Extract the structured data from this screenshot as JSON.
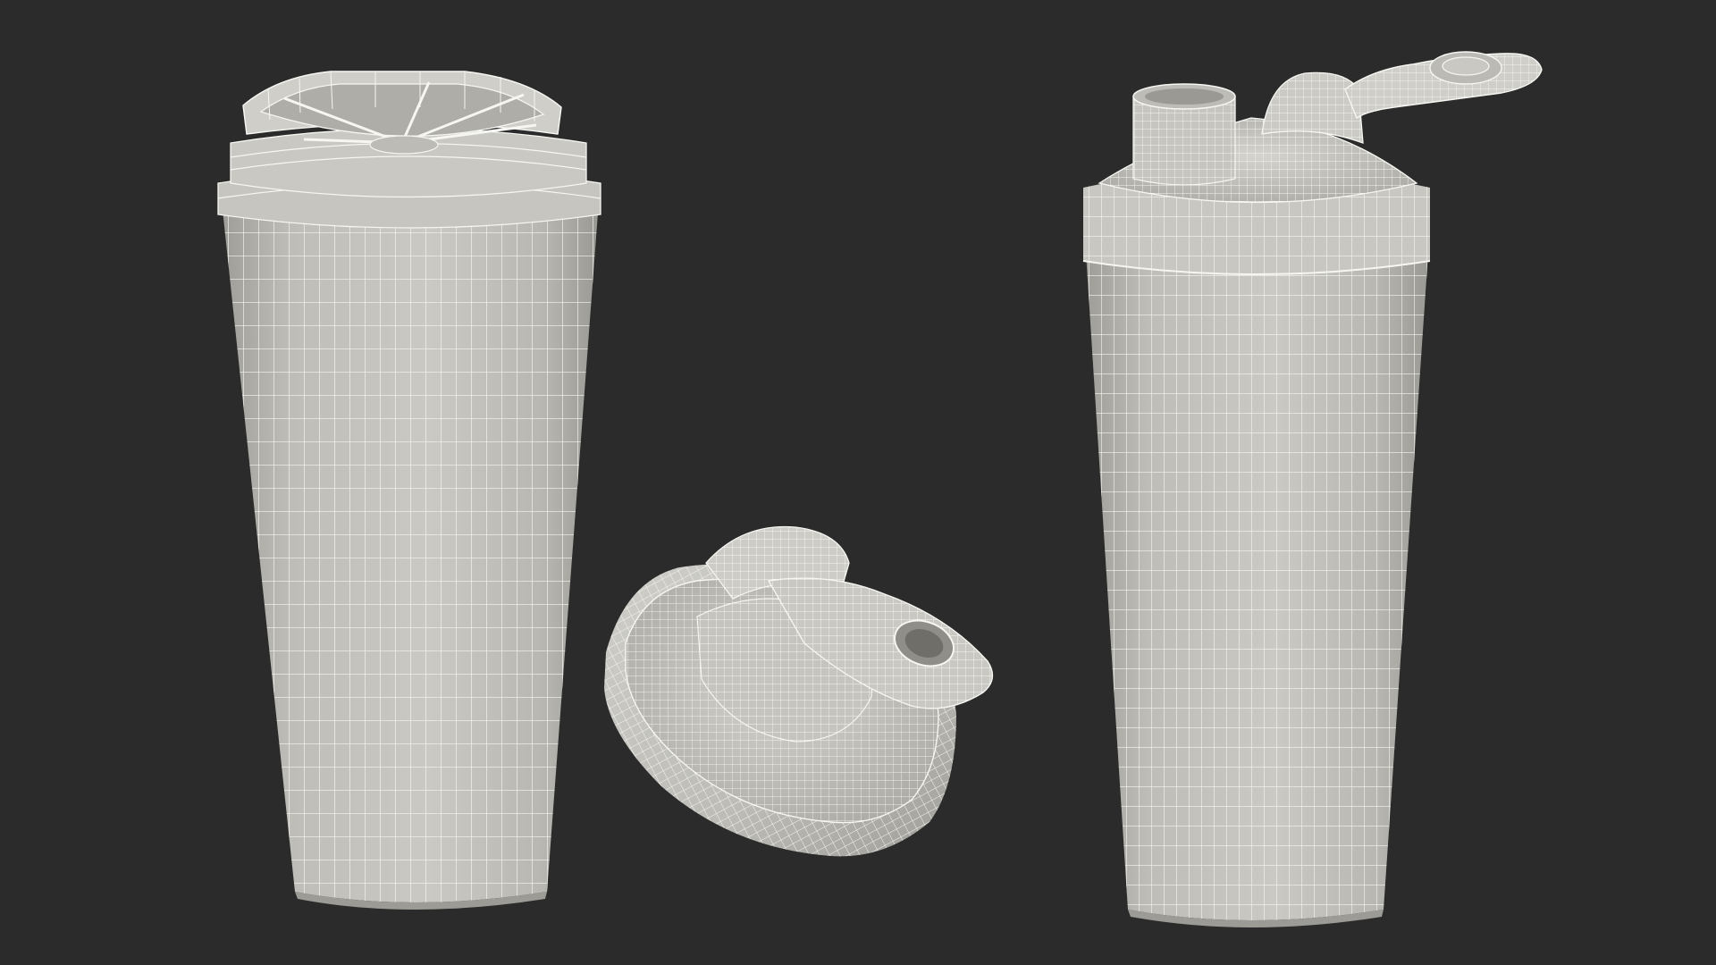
{
  "scene": {
    "background": "#2b2b2b",
    "surface_color": "#c7c6c0",
    "surface_shade": "#a9a8a2",
    "wire_color": "#f4f4f0",
    "objects": [
      "shaker-bottle-open-icon",
      "shaker-lid-icon",
      "shaker-bottle-closed-icon"
    ]
  }
}
